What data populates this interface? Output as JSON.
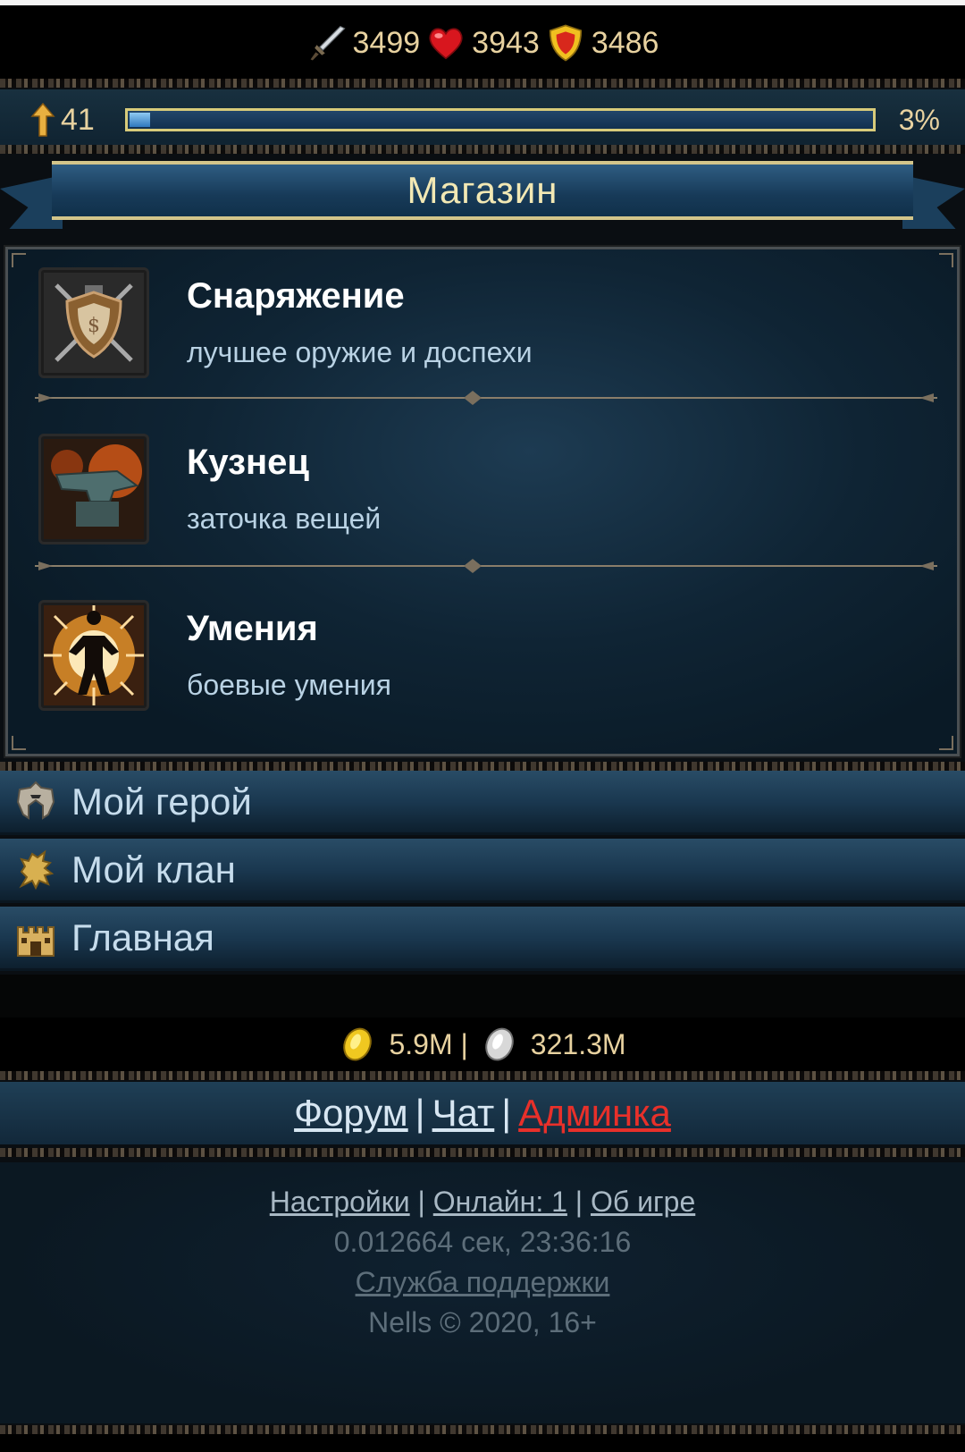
{
  "stats": {
    "attack": "3499",
    "health": "3943",
    "defense": "3486"
  },
  "level": {
    "value": "41",
    "progress_percent": 3,
    "progress_label": "3%"
  },
  "page_title": "Магазин",
  "shop_items": [
    {
      "name": "Снаряжение",
      "desc": "лучшее оружие и доспехи",
      "icon": "shield-crest-icon"
    },
    {
      "name": "Кузнец",
      "desc": "заточка вещей",
      "icon": "anvil-icon"
    },
    {
      "name": "Умения",
      "desc": "боевые умения",
      "icon": "power-figure-icon"
    }
  ],
  "nav": [
    {
      "label": "Мой герой",
      "icon": "helmet-icon"
    },
    {
      "label": "Мой клан",
      "icon": "griffin-icon"
    },
    {
      "label": "Главная",
      "icon": "castle-icon"
    }
  ],
  "currency": {
    "gold": "5.9M |",
    "silver": "321.3M"
  },
  "links": {
    "forum": "Форум ",
    "chat": "Чат ",
    "admin": "Админка",
    "sep": "|"
  },
  "footer": {
    "settings": "Настройки",
    "online": "Онлайн: 1",
    "about": "Об игре",
    "sep": "|",
    "timing": "0.012664 сек, 23:36:16",
    "support": "Служба поддержки",
    "copyright": "Nells © 2020, 16+"
  },
  "colors": {
    "accent_gold": "#e8d2a0",
    "admin_red": "#e8302a",
    "panel_blue": "#1a3850"
  }
}
